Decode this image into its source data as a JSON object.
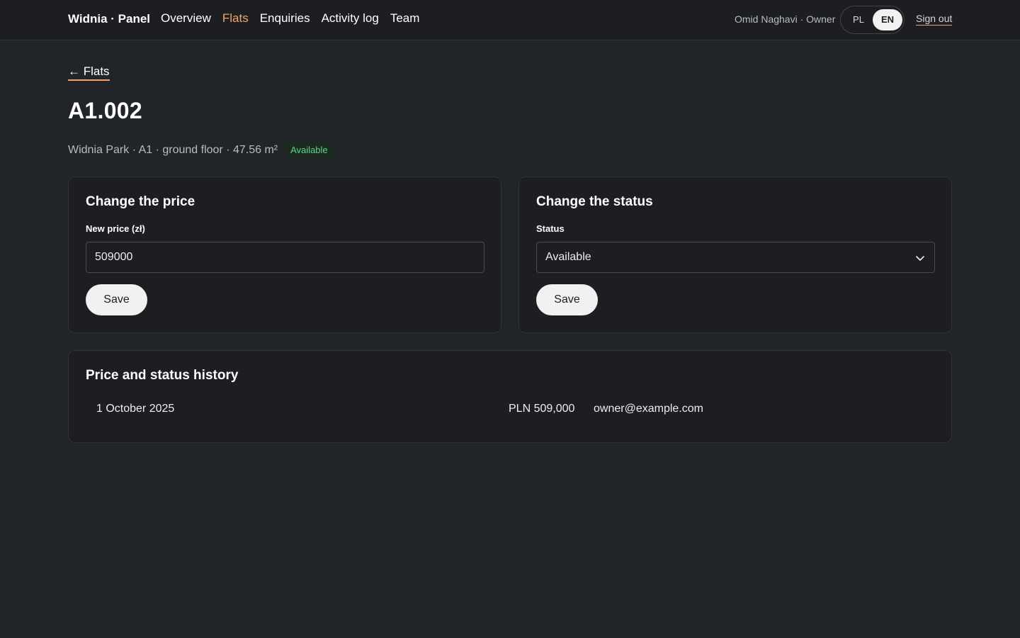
{
  "header": {
    "brand": "Widnia · Panel",
    "nav": [
      {
        "label": "Overview",
        "active": false
      },
      {
        "label": "Flats",
        "active": true
      },
      {
        "label": "Enquiries",
        "active": false
      },
      {
        "label": "Activity log",
        "active": false
      },
      {
        "label": "Team",
        "active": false
      }
    ],
    "user": "Omid Naghavi · Owner",
    "languages": [
      {
        "label": "PL",
        "selected": false
      },
      {
        "label": "EN",
        "selected": true
      }
    ],
    "sign_out": "Sign out"
  },
  "back_link": "← Flats",
  "flat": {
    "title": "A1.002",
    "subtitle": "Widnia Park · A1 · ground floor · 47.56 m²",
    "status_badge": "Available"
  },
  "price_card": {
    "heading": "Change the price",
    "field_label": "New price (zł)",
    "value": "509000",
    "save_label": "Save"
  },
  "status_card": {
    "heading": "Change the status",
    "field_label": "Status",
    "selected": "Available",
    "save_label": "Save"
  },
  "history": {
    "heading": "Price and status history",
    "rows": [
      {
        "date": "1 October 2025",
        "price": "PLN 509,000",
        "user": "owner@example.com"
      }
    ]
  },
  "colors": {
    "accent": "#f0a46a",
    "background": "#212429",
    "card": "#1c1e22",
    "badge_text": "#5fd38a"
  },
  "icons": {
    "select": "chevron-down-icon"
  }
}
